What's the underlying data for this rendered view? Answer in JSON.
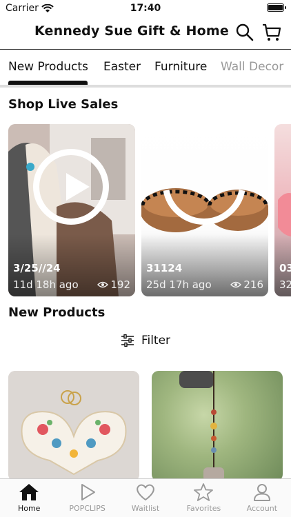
{
  "status_bar": {
    "carrier": "Carrier",
    "time": "17:40"
  },
  "header": {
    "title": "Kennedy Sue Gift & Home"
  },
  "categories": [
    "New Products",
    "Easter",
    "Furniture",
    "Wall Decor"
  ],
  "live_section": {
    "title": "Shop Live Sales",
    "cards": [
      {
        "title": "3/25//24",
        "time": "11d 18h ago",
        "views": "192"
      },
      {
        "title": "31124",
        "time": "25d 17h ago",
        "views": "216"
      },
      {
        "title": "03",
        "time": "",
        "views": "32"
      }
    ]
  },
  "products_section": {
    "title": "New Products",
    "filter_label": "Filter"
  },
  "bottom_nav": [
    "Home",
    "POPCLIPS",
    "Waitlist",
    "Favorites",
    "Account"
  ]
}
